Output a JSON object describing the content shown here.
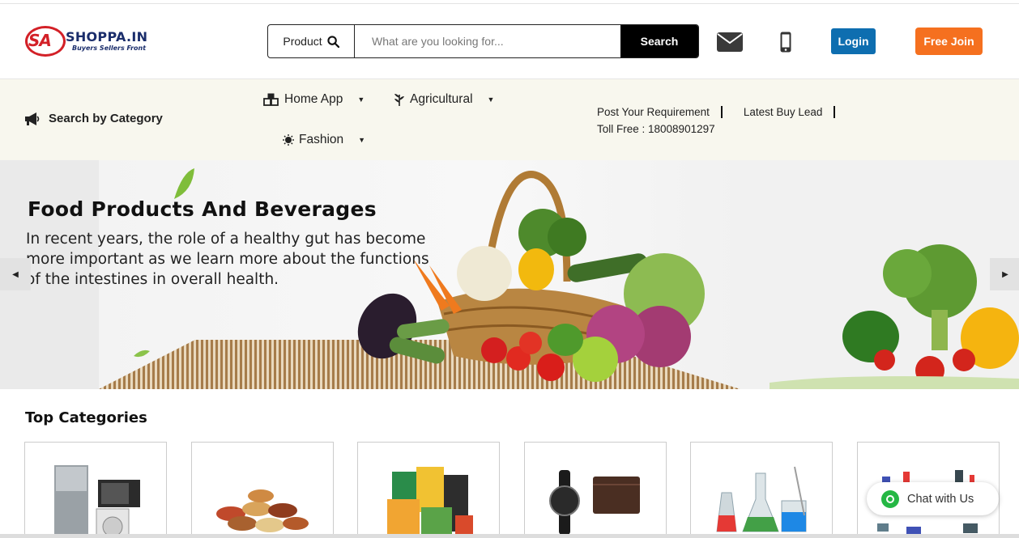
{
  "brand": {
    "logo_mark": "SA",
    "name": "SHOPPA.IN",
    "tagline": "Buyers Sellers Front"
  },
  "search": {
    "type_label": "Product",
    "placeholder": "What are you looking for...",
    "button_label": "Search"
  },
  "header_actions": {
    "mail_icon": "envelope-icon",
    "phone_icon": "mobile-phone-icon",
    "login_label": "Login",
    "join_label": "Free Join",
    "login_color": "#0e6eb0",
    "join_color": "#f5701f"
  },
  "category_bar": {
    "search_by_category": "Search by Category",
    "nav": [
      {
        "label": "Home App",
        "icon": "cubes-icon"
      },
      {
        "label": "Agricultural",
        "icon": "sprout-icon"
      },
      {
        "label": "Fashion",
        "icon": "sun-icon"
      }
    ],
    "links": {
      "post_requirement": "Post Your Requirement",
      "latest_buy_lead": "Latest Buy Lead",
      "toll_free": "Toll Free : 18008901297"
    }
  },
  "banner": {
    "title": "Food Products And Beverages",
    "text": "In recent years, the role of a healthy gut has become more important as we learn more about the functions of the intestines in overall health."
  },
  "top_categories": {
    "title": "Top Categories",
    "items": [
      {
        "image": "home-appliances-image"
      },
      {
        "image": "grains-and-spices-image"
      },
      {
        "image": "packaged-food-image"
      },
      {
        "image": "watch-and-wallet-image"
      },
      {
        "image": "lab-glassware-image"
      },
      {
        "image": "industrial-parts-image"
      }
    ]
  },
  "chat": {
    "label": "Chat with Us"
  }
}
